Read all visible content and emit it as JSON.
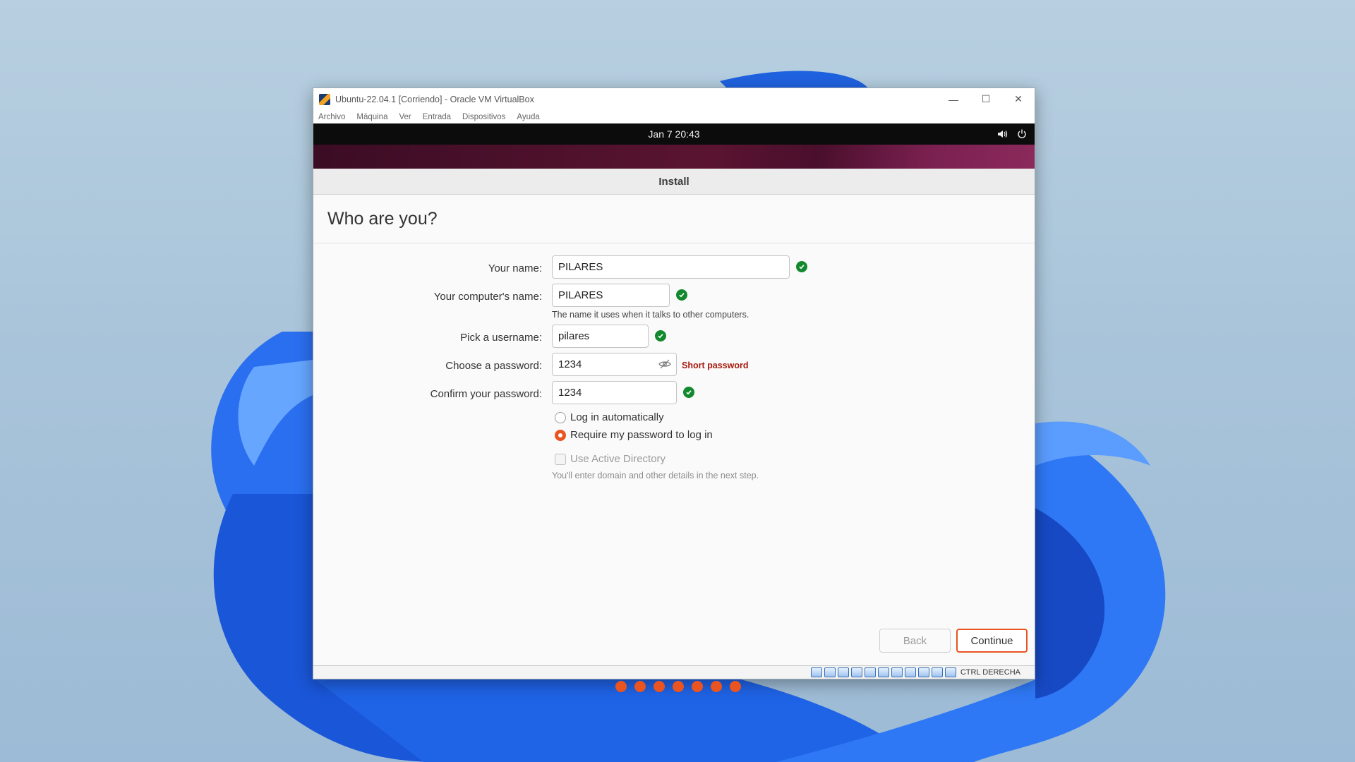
{
  "window": {
    "title": "Ubuntu-22.04.1 [Corriendo] - Oracle VM VirtualBox",
    "controls": {
      "minimize": "—",
      "maximize": "☐",
      "close": "✕"
    },
    "menu": [
      "Archivo",
      "Máquina",
      "Ver",
      "Entrada",
      "Dispositivos",
      "Ayuda"
    ]
  },
  "topbar": {
    "datetime": "Jan 7  20:43",
    "icons": [
      "volume-icon",
      "power-icon"
    ]
  },
  "installer": {
    "header": "Install",
    "title": "Who are you?",
    "fields": {
      "name": {
        "label": "Your name:",
        "value": "PILARES",
        "valid": true
      },
      "computer": {
        "label": "Your computer's name:",
        "value": "PILARES",
        "valid": true,
        "hint": "The name it uses when it talks to other computers."
      },
      "username": {
        "label": "Pick a username:",
        "value": "pilares",
        "valid": true
      },
      "password": {
        "label": "Choose a password:",
        "value": "1234",
        "strength": "Short password"
      },
      "confirm": {
        "label": "Confirm your password:",
        "value": "1234",
        "valid": true
      }
    },
    "login": {
      "auto": {
        "label": "Log in automatically",
        "selected": false
      },
      "require": {
        "label": "Require my password to log in",
        "selected": true
      }
    },
    "active_directory": {
      "label": "Use Active Directory",
      "checked": false,
      "enabled": false,
      "hint": "You'll enter domain and other details in the next step."
    },
    "buttons": {
      "back": "Back",
      "continue": "Continue"
    },
    "progress": {
      "total_steps": 7,
      "completed_steps": 7
    }
  },
  "statusbar": {
    "host_key": "CTRL DERECHA",
    "icons": [
      "hdd-icon",
      "optical-drive-icon",
      "audio-icon",
      "network-icon",
      "usb-icon",
      "shared-folder-icon",
      "display-icon",
      "recording-icon",
      "cpu-icon",
      "mouse-integration-icon",
      "keyboard-icon"
    ]
  },
  "colors": {
    "accent": "#e95420",
    "valid": "#13892e",
    "warning": "#a61b0f"
  }
}
